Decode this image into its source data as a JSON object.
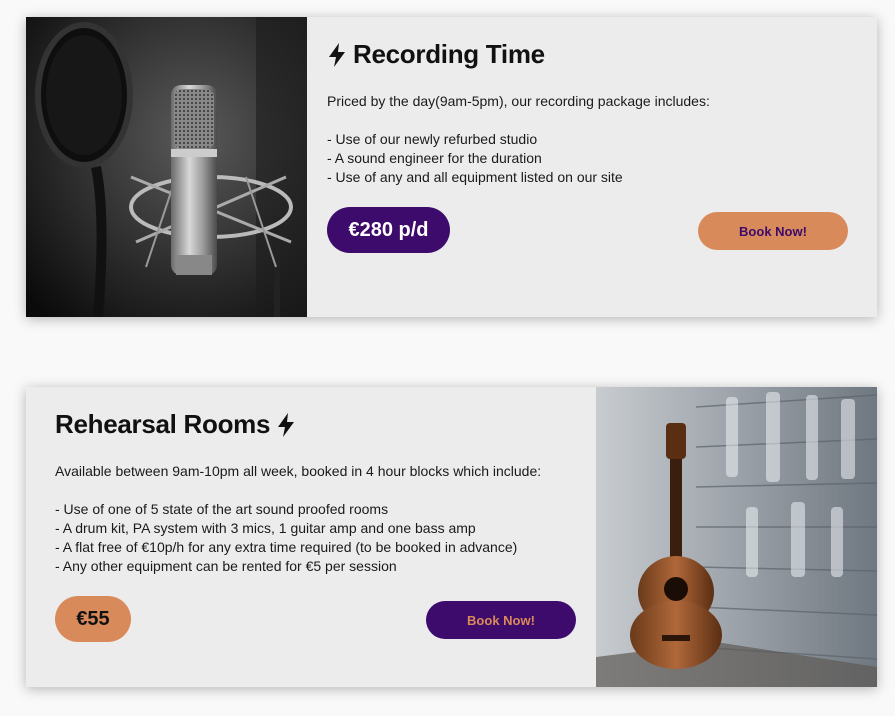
{
  "cards": [
    {
      "title": "Recording Time",
      "description_intro": "Priced by the day(9am-5pm), our recording package includes:",
      "features": [
        "- Use of our newly refurbed studio",
        "- A sound engineer for the duration",
        "- Use of any and all equipment listed on our site"
      ],
      "price": "€280 p/d",
      "button_label": "Book Now!",
      "icon": "lightning-bolt-icon",
      "image": "studio-microphone-photo"
    },
    {
      "title": "Rehearsal Rooms",
      "description_intro": "Available between 9am-10pm all week, booked in 4 hour blocks which include:",
      "features": [
        "- Use of one of 5 state of the art sound proofed rooms",
        "- A drum kit, PA system with 3 mics, 1 guitar amp and one bass amp",
        "- A flat free of €10p/h for any extra time required (to be booked in advance)",
        "- Any other equipment can be rented for €5 per session"
      ],
      "price": "€55",
      "button_label": "Book Now!",
      "icon": "lightning-bolt-icon",
      "image": "acoustic-guitar-photo"
    }
  ],
  "colors": {
    "purple": "#3d0b6b",
    "orange": "#d98a5a",
    "card_bg": "#ececec"
  }
}
